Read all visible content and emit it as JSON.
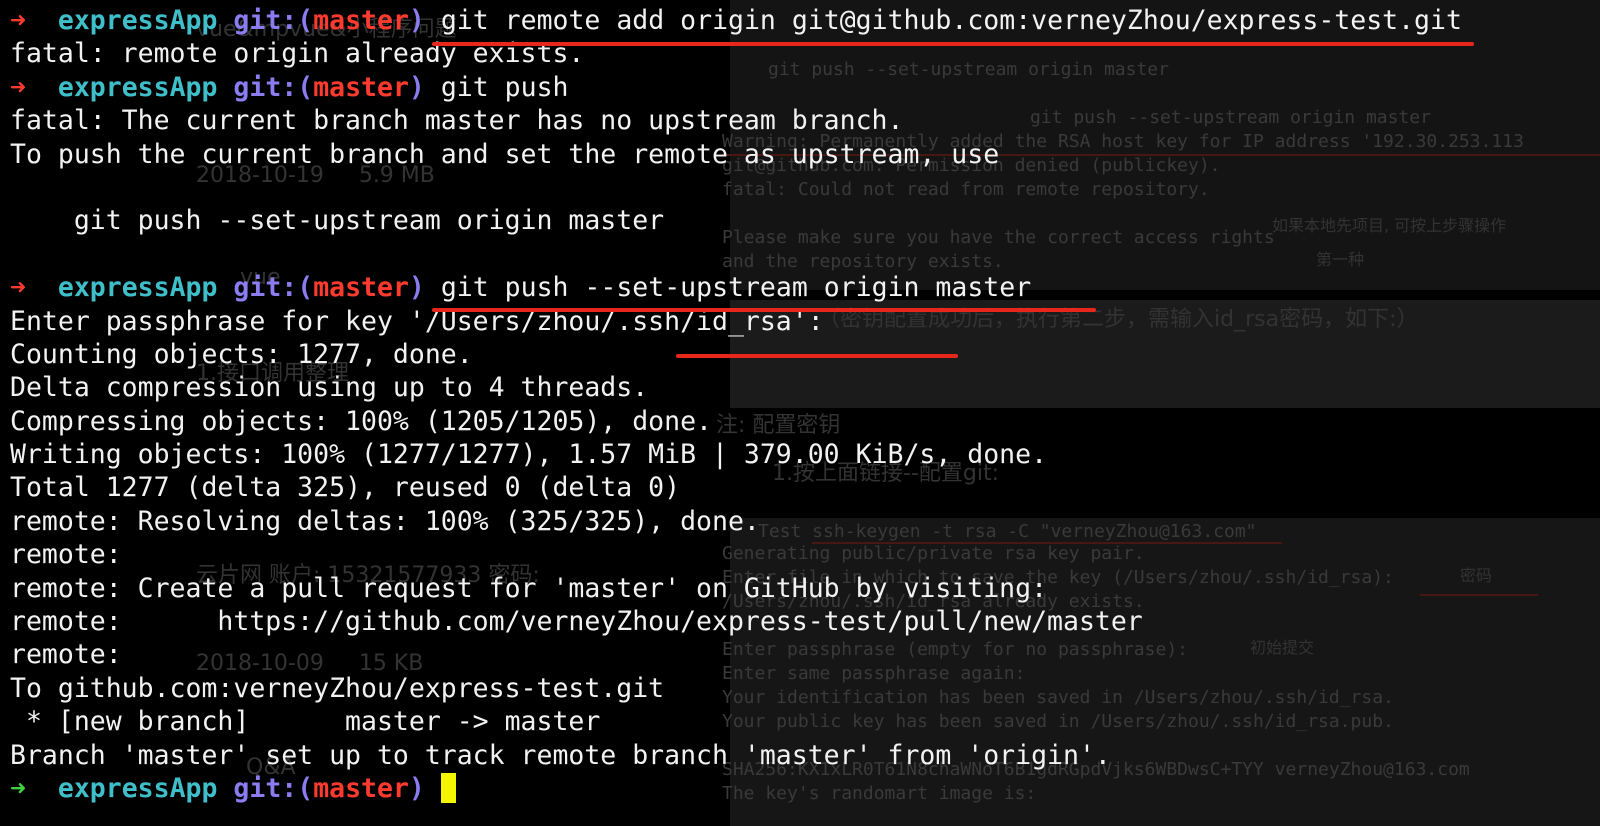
{
  "prompt": {
    "dir": "expressApp",
    "git_label": "git:(",
    "branch": "master",
    "close": ")",
    "arrow": "➜"
  },
  "lines": [
    {
      "type": "prompt",
      "status": "error",
      "cmd": " git remote add origin git@github.com:verneyZhou/express-test.git"
    },
    {
      "type": "out",
      "text": "fatal: remote origin already exists."
    },
    {
      "type": "prompt",
      "status": "error",
      "cmd": " git push"
    },
    {
      "type": "out",
      "text": "fatal: The current branch master has no upstream branch."
    },
    {
      "type": "out",
      "text": "To push the current branch and set the remote as upstream, use"
    },
    {
      "type": "out",
      "text": ""
    },
    {
      "type": "out",
      "text": "    git push --set-upstream origin master"
    },
    {
      "type": "out",
      "text": ""
    },
    {
      "type": "prompt",
      "status": "error",
      "cmd": " git push --set-upstream origin master"
    },
    {
      "type": "out",
      "text": "Enter passphrase for key '/Users/zhou/.ssh/id_rsa':"
    },
    {
      "type": "out",
      "text": "Counting objects: 1277, done."
    },
    {
      "type": "out",
      "text": "Delta compression using up to 4 threads."
    },
    {
      "type": "out",
      "text": "Compressing objects: 100% (1205/1205), done."
    },
    {
      "type": "out",
      "text": "Writing objects: 100% (1277/1277), 1.57 MiB | 379.00 KiB/s, done."
    },
    {
      "type": "out",
      "text": "Total 1277 (delta 325), reused 0 (delta 0)"
    },
    {
      "type": "out",
      "text": "remote: Resolving deltas: 100% (325/325), done."
    },
    {
      "type": "out",
      "text": "remote:"
    },
    {
      "type": "out",
      "text": "remote: Create a pull request for 'master' on GitHub by visiting:"
    },
    {
      "type": "out",
      "text": "remote:      https://github.com/verneyZhou/express-test/pull/new/master"
    },
    {
      "type": "out",
      "text": "remote:"
    },
    {
      "type": "out",
      "text": "To github.com:verneyZhou/express-test.git"
    },
    {
      "type": "out",
      "text": " * [new branch]      master -> master"
    },
    {
      "type": "out",
      "text": "Branch 'master' set up to track remote branch 'master' from 'origin'."
    },
    {
      "type": "prompt",
      "status": "ok",
      "cmd": " "
    }
  ],
  "background_text": {
    "top_right": [
      "git push --set-upstream origin master",
      "git push --set-upstream origin master",
      "Warning: Permanently added the RSA host key for IP address '192.30.253.113",
      "git@github.com: Permission denied (publickey).",
      "fatal: Could not read from remote repository.",
      "Please make sure you have the correct access rights",
      "and the repository exists."
    ],
    "note_right": "（密钥配置成功后，执行第二步，需输入id_rsa密码，如下:）",
    "heading": "注: 配置密钥",
    "step": "1.按上面链接--配置git:",
    "bottom_right": [
      "Test ssh-keygen -t rsa -C \"verneyZhou@163.com\"",
      "Generating public/private rsa key pair.",
      "Enter file in which to save the key (/Users/zhou/.ssh/id_rsa):",
      "/Users/zhou/.ssh/id_rsa already exists.",
      "Enter passphrase (empty for no passphrase):",
      "Enter same passphrase again:",
      "Your identification has been saved in /Users/zhou/.ssh/id_rsa.",
      "Your public key has been saved in /Users/zhou/.ssh/id_rsa.pub.",
      "SHA256:KX1xLR0T61N8chaWNoT6B1gdRGpdVjks6WBDwsC+TYY verneyZhou@163.com",
      "The key's randomart image is:"
    ],
    "left_ghost": [
      "vue&mpvue&小程序问题",
      "2018-10-19     5.9 MB",
      "vue",
      "1.接口调用整理",
      "云片网 账户: 15321577933 密码:",
      "2018-10-09     15 KB",
      "Q&A"
    ],
    "marks": [
      "密码",
      "初始提交",
      "第一种",
      "如果本地先项目, 可按上步骤操作"
    ]
  },
  "colors": {
    "background": "#000000",
    "text": "#f2f2f2",
    "prompt_dir": "#3fbfc9",
    "prompt_git": "#8b7cf0",
    "prompt_branch": "#ff3b30",
    "arrow_error": "#ff3b30",
    "arrow_ok": "#3fd13f",
    "cursor": "#f5f500",
    "underline": "#e8261c"
  }
}
